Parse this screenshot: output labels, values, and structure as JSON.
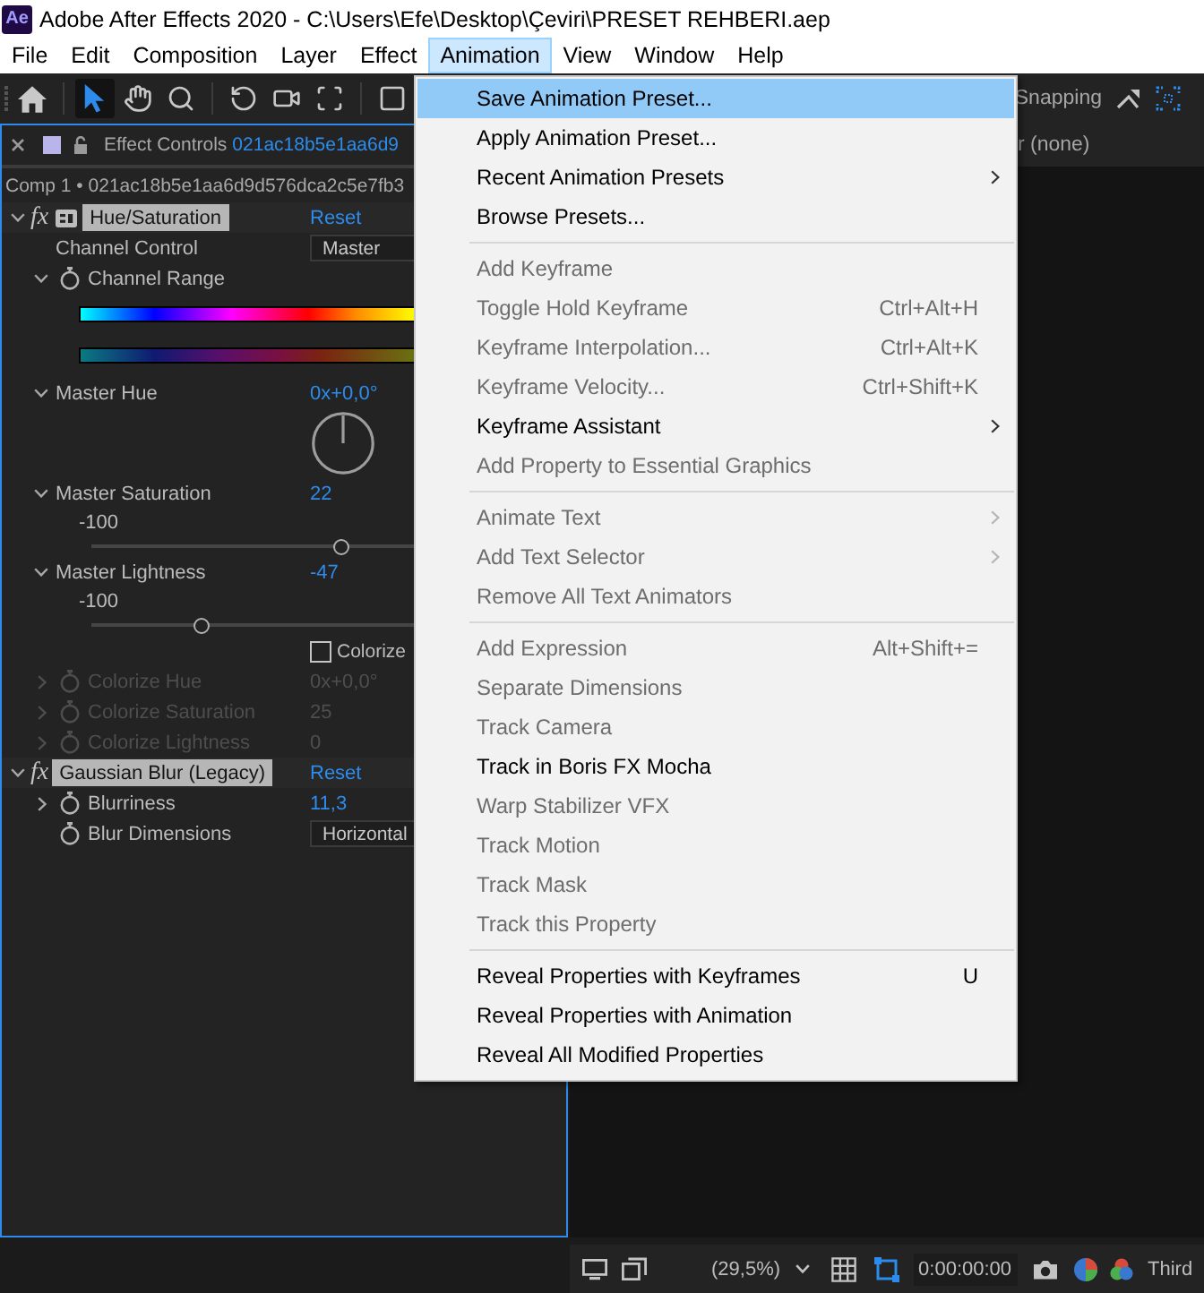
{
  "window": {
    "app_icon": "Ae",
    "title": "Adobe After Effects 2020 - C:\\Users\\Efe\\Desktop\\Çeviri\\PRESET REHBERI.aep"
  },
  "menubar": [
    {
      "label": "File",
      "selected": false
    },
    {
      "label": "Edit",
      "selected": false
    },
    {
      "label": "Composition",
      "selected": false
    },
    {
      "label": "Layer",
      "selected": false
    },
    {
      "label": "Effect",
      "selected": false
    },
    {
      "label": "Animation",
      "selected": true
    },
    {
      "label": "View",
      "selected": false
    },
    {
      "label": "Window",
      "selected": false
    },
    {
      "label": "Help",
      "selected": false
    }
  ],
  "toolbar": {
    "tool_groups": [
      [
        {
          "kind": "home",
          "selected": false
        }
      ],
      [
        {
          "kind": "selection",
          "selected": true
        },
        {
          "kind": "hand",
          "selected": false
        },
        {
          "kind": "zoom",
          "selected": false
        }
      ],
      [
        {
          "kind": "rotation",
          "selected": false
        },
        {
          "kind": "camera",
          "selected": false
        },
        {
          "kind": "pan_behind",
          "selected": false
        }
      ],
      [
        {
          "kind": "rectangle",
          "selected": false
        }
      ]
    ],
    "snapping": "Snapping"
  },
  "effect_controls": {
    "title": "Effect Controls",
    "layer_name": "021ac18b5e1aa6d9",
    "breadcrumb": "Comp 1 • 021ac18b5e1aa6d9d576dca2c5e7fb3",
    "effects": [
      {
        "fx": "fx",
        "enabled": true,
        "badge": true,
        "name": "Hue/Saturation",
        "selected": true,
        "expanded": true,
        "reset": "Reset",
        "properties": [
          {
            "kind": "dropdown",
            "label": "Channel Control",
            "stopwatch": false,
            "disabled": false,
            "value": "Master"
          },
          {
            "kind": "color_range",
            "label": "Channel Range",
            "expanded": true,
            "stopwatch": true,
            "disabled": false
          },
          {
            "kind": "angle",
            "label": "Master Hue",
            "expanded": true,
            "stopwatch": false,
            "disabled": false,
            "value": "0x+0,0°"
          },
          {
            "kind": "slider",
            "label": "Master Saturation",
            "expanded": true,
            "stopwatch": false,
            "disabled": false,
            "value": "22",
            "min_label": "-100",
            "level": 0.77
          },
          {
            "kind": "slider",
            "label": "Master Lightness",
            "expanded": true,
            "stopwatch": false,
            "disabled": false,
            "value": "-47",
            "min_label": "-100",
            "level": 0.34
          },
          {
            "kind": "checkbox",
            "stopwatch": false,
            "disabled": false,
            "checked": false,
            "text": "Colorize"
          },
          {
            "kind": "value",
            "label": "Colorize Hue",
            "expanded": false,
            "stopwatch": true,
            "disabled": true,
            "value": "0x+0,0°"
          },
          {
            "kind": "value",
            "label": "Colorize Saturation",
            "expanded": false,
            "stopwatch": true,
            "disabled": true,
            "value": "25"
          },
          {
            "kind": "value",
            "label": "Colorize Lightness",
            "expanded": false,
            "stopwatch": true,
            "disabled": true,
            "value": "0"
          }
        ]
      },
      {
        "fx": "fx",
        "enabled": true,
        "badge": false,
        "name": "Gaussian Blur (Legacy)",
        "selected": true,
        "expanded": true,
        "reset": "Reset",
        "properties": [
          {
            "kind": "value",
            "label": "Blurriness",
            "expanded": false,
            "stopwatch": true,
            "disabled": false,
            "value": "11,3"
          },
          {
            "kind": "dropdown",
            "label": "Blur Dimensions",
            "stopwatch": true,
            "disabled": false,
            "value": "Horizontal"
          }
        ]
      }
    ]
  },
  "viewer": {
    "header": "r (none)",
    "footer": {
      "magnification": "(29,5%)",
      "timecode": "0:00:00:00",
      "resolution": "Third"
    }
  },
  "animation_menu": {
    "groups": [
      {
        "items": [
          {
            "label": "Save Animation Preset...",
            "submenu": false,
            "disabled": false,
            "selected": true
          },
          {
            "label": "Apply Animation Preset...",
            "submenu": false,
            "disabled": false,
            "selected": false
          },
          {
            "label": "Recent Animation Presets",
            "submenu": true,
            "disabled": false,
            "selected": false
          },
          {
            "label": "Browse Presets...",
            "submenu": false,
            "disabled": false,
            "selected": false
          }
        ]
      },
      {
        "items": [
          {
            "label": "Add Keyframe",
            "submenu": false,
            "disabled": true,
            "selected": false
          },
          {
            "label": "Toggle Hold Keyframe",
            "shortcut": "Ctrl+Alt+H",
            "submenu": false,
            "disabled": true,
            "selected": false
          },
          {
            "label": "Keyframe Interpolation...",
            "shortcut": "Ctrl+Alt+K",
            "submenu": false,
            "disabled": true,
            "selected": false
          },
          {
            "label": "Keyframe Velocity...",
            "shortcut": "Ctrl+Shift+K",
            "submenu": false,
            "disabled": true,
            "selected": false
          },
          {
            "label": "Keyframe Assistant",
            "submenu": true,
            "disabled": false,
            "selected": false
          },
          {
            "label": "Add Property to Essential Graphics",
            "submenu": false,
            "disabled": true,
            "selected": false
          }
        ]
      },
      {
        "items": [
          {
            "label": "Animate Text",
            "submenu": true,
            "disabled": true,
            "selected": false
          },
          {
            "label": "Add Text Selector",
            "submenu": true,
            "disabled": true,
            "selected": false
          },
          {
            "label": "Remove All Text Animators",
            "submenu": false,
            "disabled": true,
            "selected": false
          }
        ]
      },
      {
        "items": [
          {
            "label": "Add Expression",
            "shortcut": "Alt+Shift+=",
            "submenu": false,
            "disabled": true,
            "selected": false
          },
          {
            "label": "Separate Dimensions",
            "submenu": false,
            "disabled": true,
            "selected": false
          },
          {
            "label": "Track Camera",
            "submenu": false,
            "disabled": true,
            "selected": false
          },
          {
            "label": "Track in Boris FX Mocha",
            "submenu": false,
            "disabled": false,
            "selected": false
          },
          {
            "label": "Warp Stabilizer VFX",
            "submenu": false,
            "disabled": true,
            "selected": false
          },
          {
            "label": "Track Motion",
            "submenu": false,
            "disabled": true,
            "selected": false
          },
          {
            "label": "Track Mask",
            "submenu": false,
            "disabled": true,
            "selected": false
          },
          {
            "label": "Track this Property",
            "submenu": false,
            "disabled": true,
            "selected": false
          }
        ]
      },
      {
        "items": [
          {
            "label": "Reveal Properties with Keyframes",
            "shortcut": "U",
            "submenu": false,
            "disabled": false,
            "selected": false
          },
          {
            "label": "Reveal Properties with Animation",
            "submenu": false,
            "disabled": false,
            "selected": false
          },
          {
            "label": "Reveal All Modified Properties",
            "submenu": false,
            "disabled": false,
            "selected": false
          }
        ]
      }
    ]
  }
}
